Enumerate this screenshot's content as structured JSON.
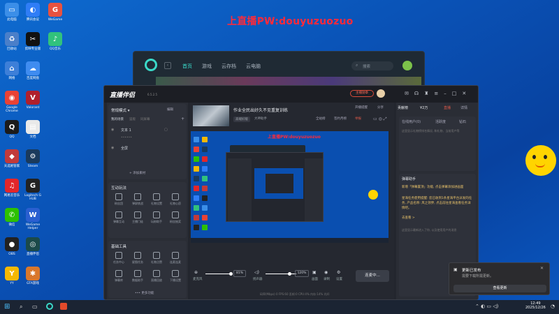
{
  "watermark": "上直播PW:douyuzuozuo",
  "desktop_icons": [
    {
      "label": "此电脑",
      "color": "#3b8ee8",
      "glyph": "▭"
    },
    {
      "label": "回收站",
      "color": "#4a7fc9",
      "glyph": "♻"
    },
    {
      "label": "网络",
      "color": "#3d7fd8",
      "glyph": "⌂"
    },
    {
      "label": "Google Chrome",
      "color": "#e94235",
      "glyph": "◉"
    },
    {
      "label": "QQ",
      "color": "#1b1b1b",
      "glyph": "Q"
    },
    {
      "label": "天选姬管家",
      "color": "#c23a3a",
      "glyph": "◆"
    },
    {
      "label": "网易云音乐",
      "color": "#e3262a",
      "glyph": "♫"
    },
    {
      "label": "微信",
      "color": "#2dc100",
      "glyph": "✆"
    },
    {
      "label": "OBS",
      "color": "#222",
      "glyph": "●"
    },
    {
      "label": "YY",
      "color": "#f5b800",
      "glyph": "Y"
    }
  ],
  "desktop_icons_col2": [
    {
      "label": "腾讯会议",
      "color": "#2f7df6",
      "glyph": "◐"
    },
    {
      "label": "剪映专业版",
      "color": "#111",
      "glyph": "✂"
    },
    {
      "label": "百度网盘",
      "color": "#3f8cf0",
      "glyph": "☁"
    },
    {
      "label": "Valorant",
      "color": "#b0202c",
      "glyph": "V"
    },
    {
      "label": "文档",
      "color": "#e9e9e9",
      "glyph": "▤"
    },
    {
      "label": "Steam",
      "color": "#1a3a5c",
      "glyph": "⚙"
    },
    {
      "label": "Logitech G HUB",
      "color": "#222",
      "glyph": "G"
    },
    {
      "label": "WeGame Helper",
      "color": "#2a5fd0",
      "glyph": "W"
    },
    {
      "label": "直播伴侣",
      "color": "#1b4a4a",
      "glyph": "◎"
    },
    {
      "label": "GTA游戏",
      "color": "#d9772b",
      "glyph": "✱"
    }
  ],
  "desktop_icons_col3": [
    {
      "label": "WeGame",
      "color": "#e8523f",
      "glyph": "G"
    },
    {
      "label": "QQ音乐",
      "color": "#31c27c",
      "glyph": "♪"
    }
  ],
  "back_window": {
    "nav": [
      "首页",
      "游戏",
      "云存档",
      "云电脑"
    ],
    "search_placeholder": "搜索"
  },
  "app": {
    "title": "直播伴侣",
    "version": "6.5.2.5",
    "stream_title": "作业全民出好久不见重复训练",
    "stream_tag": "快速重播",
    "stream_cat": "高端好版",
    "stream_cat2": "大神助手",
    "top_icons": [
      "开播提醒",
      "分享",
      "全站榜",
      "签约月榜",
      "举报"
    ],
    "scene_mode": "常规模式",
    "scene_edit": "编辑",
    "scene_list_head": "我的场景",
    "scene_tabs": [
      "竖版",
      "同屏幕"
    ],
    "sources": [
      "文本 1",
      "全屏"
    ],
    "add_source": "+ 添加素材",
    "interact_head": "互动玩法",
    "interact_items": [
      "粉丝团",
      "弹屏挑战",
      "礼物设置",
      "礼物心愿",
      "弹幕互动",
      "主播门徒",
      "玩粉助手",
      "粉丝抽奖"
    ],
    "tools_head": "基础工具",
    "tool_items": [
      "任务中心",
      "星图任务",
      "礼物点赞",
      "连麦连麦",
      "弹幕库",
      "数据助手",
      "直播回放",
      "下播设置"
    ],
    "more_tools": "••• 更多功能",
    "mic_label": "麦克风",
    "mic_level": "81%",
    "speaker_label": "扬声器",
    "speaker_level": "120%",
    "bottom_icons": [
      "画面",
      "录制",
      "设置"
    ],
    "start_button": "连麦中...",
    "status_line": "码率(Mbps) 0  FPS:60  丢帧:0  CPU:4%  内存:14%  光纤",
    "right": {
      "tab1": "贡献榜",
      "tab2": "¥2万",
      "tab3": "直播",
      "tab4": "详情",
      "online": "在线用户(0)",
      "fans": "活跃度",
      "more": "钻石",
      "hint": "这里显示礼物榜排名情况, 和礼物、当前用户等",
      "danmu_head": "弹幕助手",
      "notice1": "新增「弹幕置顶」功能, 点击弹幕添加进画面",
      "notice2": "星海任务使用提醒: 您已收到1条星海平台派发的任务, 产品名称: 风之领界, 点击前往星海查看任务详情吧。",
      "notice_link": "去查看 >",
      "empty": "这里显示最新进入了你, 以及使用用户的消息"
    }
  },
  "toast": {
    "title": "更新已发布",
    "body": "需要下载所需更新。",
    "button": "查看更新"
  },
  "taskbar": {
    "time": "12:49",
    "date": "2025/12/26"
  }
}
